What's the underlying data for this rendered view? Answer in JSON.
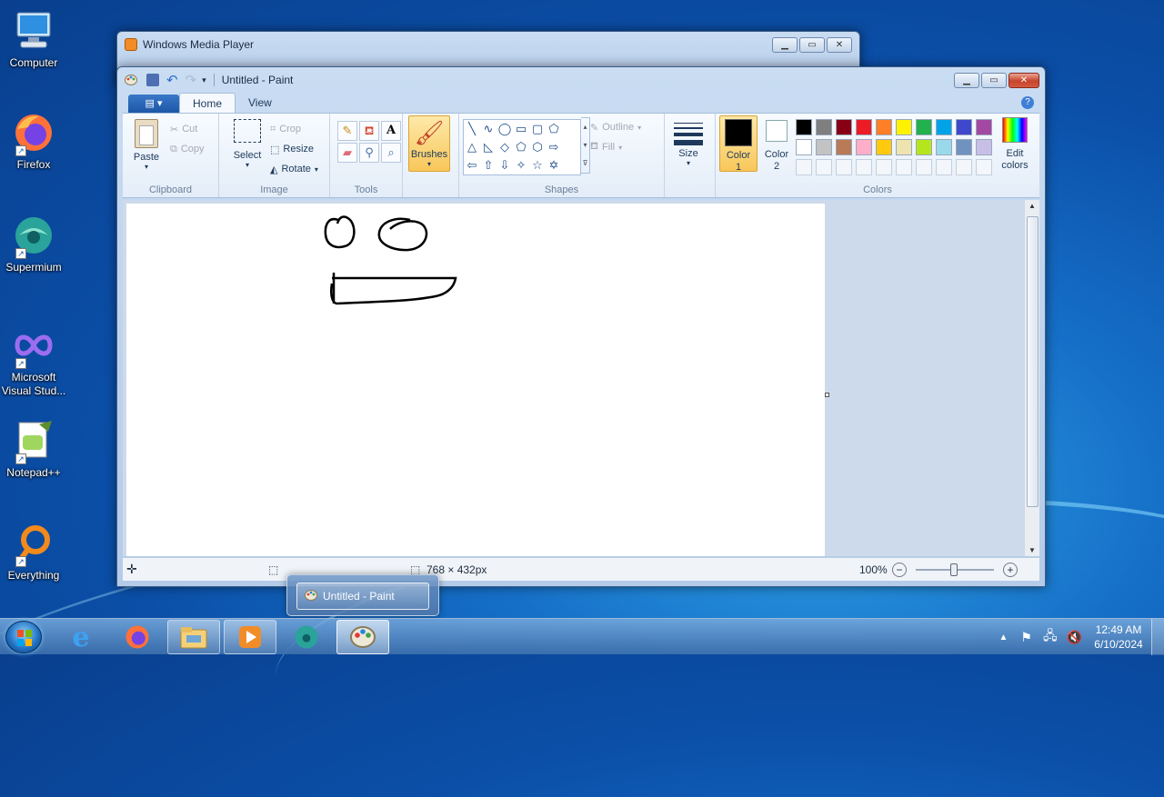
{
  "desktop": {
    "icons": [
      {
        "label": "Computer"
      },
      {
        "label": "Firefox"
      },
      {
        "label": "Supermium"
      },
      {
        "label": "Microsoft Visual Stud..."
      },
      {
        "label": "Notepad++"
      },
      {
        "label": "Everything"
      }
    ]
  },
  "wmp": {
    "title": "Windows Media Player"
  },
  "paint": {
    "title": "Untitled - Paint",
    "file_tab": "▤ ▾",
    "tabs": [
      "Home",
      "View"
    ],
    "clipboard": {
      "paste": "Paste",
      "cut": "Cut",
      "copy": "Copy",
      "label": "Clipboard"
    },
    "image": {
      "select": "Select",
      "crop": "Crop",
      "resize": "Resize",
      "rotate": "Rotate",
      "label": "Image"
    },
    "tools": {
      "label": "Tools"
    },
    "brushes": {
      "label": "Brushes"
    },
    "shapes": {
      "outline": "Outline",
      "fill": "Fill",
      "label": "Shapes"
    },
    "size": {
      "label": "Size"
    },
    "colors": {
      "color1": "Color 1",
      "color1_line2": "1",
      "color2": "Color",
      "color2_line2": "2",
      "edit": "Edit",
      "edit_line2": "colors",
      "label": "Colors",
      "color1_value": "#000000",
      "color2_value": "#ffffff",
      "palette": [
        "#000000",
        "#7f7f7f",
        "#880015",
        "#ed1c24",
        "#ff7f27",
        "#fff200",
        "#22b14c",
        "#00a2e8",
        "#3f48cc",
        "#a349a4",
        "#ffffff",
        "#c3c3c3",
        "#b97a57",
        "#ffaec9",
        "#ffc90e",
        "#efe4b0",
        "#b5e61d",
        "#99d9ea",
        "#7092be",
        "#c8bfe7",
        "",
        "",
        "",
        "",
        "",
        "",
        "",
        "",
        "",
        ""
      ]
    },
    "status": {
      "dimensions": "768 × 432px",
      "zoom": "100%"
    }
  },
  "taskbar": {
    "time": "12:49 AM",
    "date": "6/10/2024",
    "preview_title": "Untitled - Paint"
  }
}
